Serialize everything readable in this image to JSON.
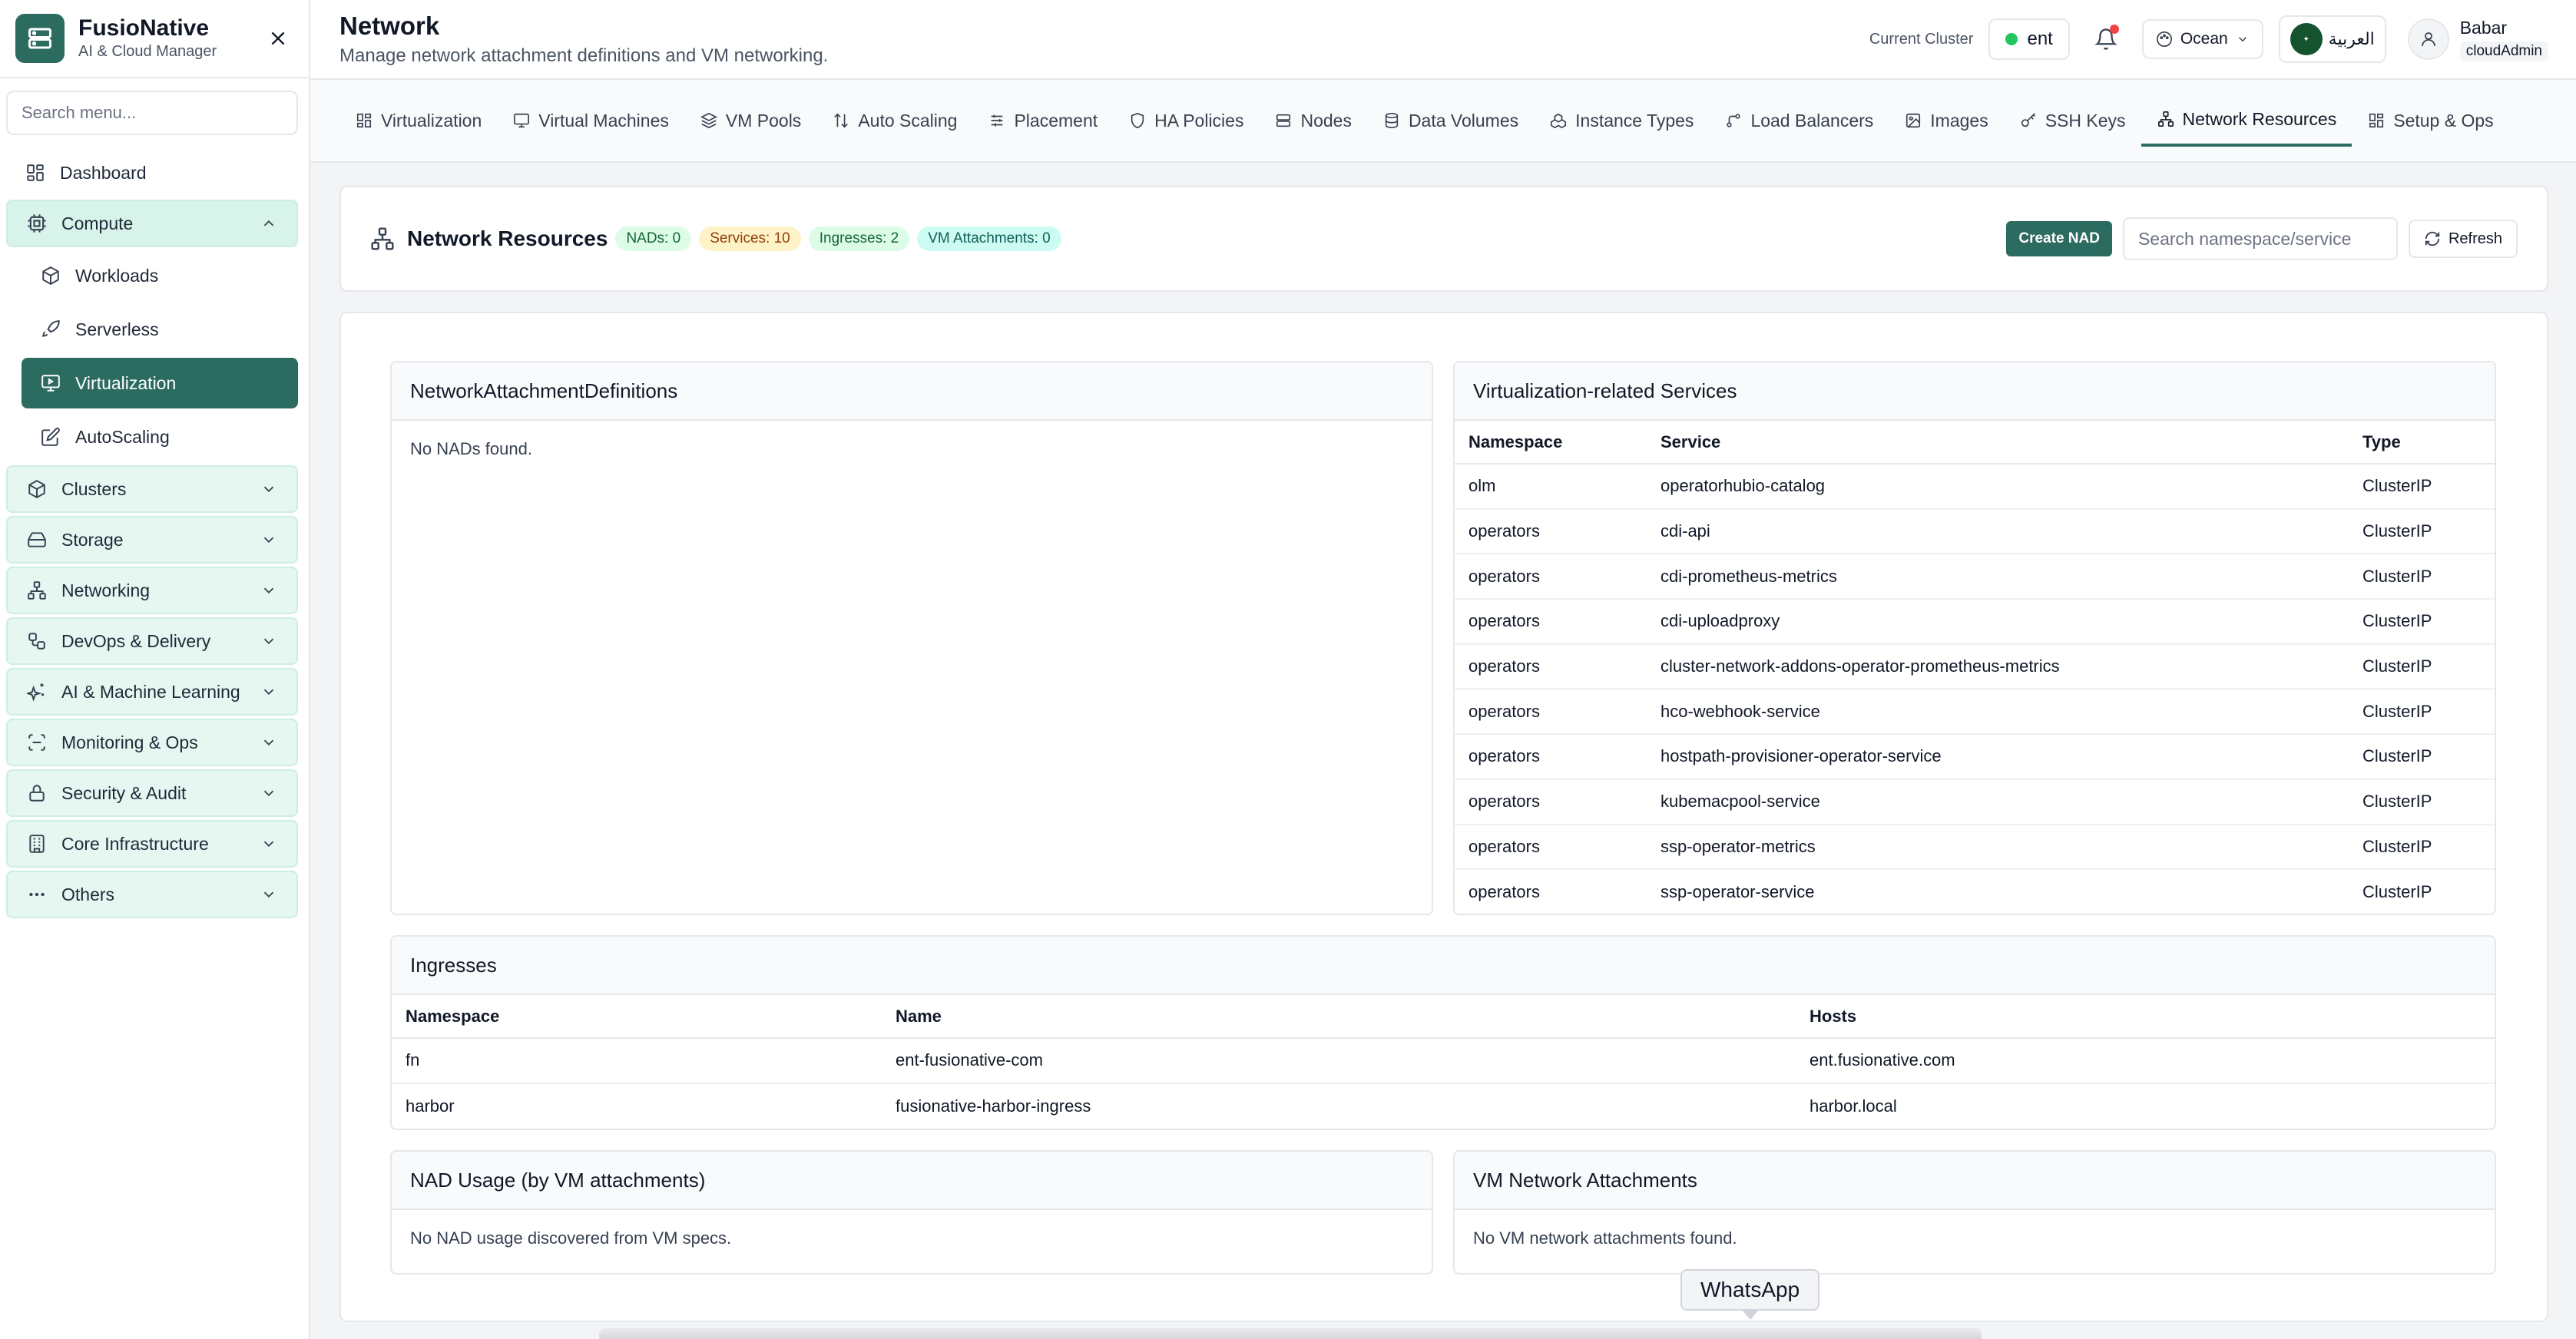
{
  "brand": {
    "name": "FusioNative",
    "subtitle": "AI & Cloud Manager"
  },
  "sidebar": {
    "search_placeholder": "Search menu...",
    "dashboard": "Dashboard",
    "compute": {
      "label": "Compute",
      "children": [
        "Workloads",
        "Serverless",
        "Virtualization",
        "AutoScaling"
      ],
      "active": "Virtualization"
    },
    "groups": [
      "Clusters",
      "Storage",
      "Networking",
      "DevOps & Delivery",
      "AI & Machine Learning",
      "Monitoring & Ops",
      "Security & Audit",
      "Core Infrastructure",
      "Others"
    ]
  },
  "header": {
    "title": "Network",
    "subtitle": "Manage network attachment definitions and VM networking.",
    "cluster_label": "Current Cluster",
    "cluster_name": "ent",
    "theme": "Ocean",
    "language": "العربية",
    "user_name": "Babar",
    "user_role": "cloudAdmin"
  },
  "tabs": {
    "items": [
      "Virtualization",
      "Virtual Machines",
      "VM Pools",
      "Auto Scaling",
      "Placement",
      "HA Policies",
      "Nodes",
      "Data Volumes",
      "Instance Types",
      "Load Balancers",
      "Images",
      "SSH Keys",
      "Network Resources",
      "Setup & Ops"
    ],
    "active": "Network Resources"
  },
  "resources": {
    "title": "Network Resources",
    "badges": {
      "nads": "NADs: 0",
      "services": "Services: 10",
      "ingresses": "Ingresses: 2",
      "vm_attachments": "VM Attachments: 0"
    },
    "create_button": "Create NAD",
    "search_placeholder": "Search namespace/service",
    "refresh_button": "Refresh"
  },
  "nads": {
    "title": "NetworkAttachmentDefinitions",
    "empty": "No NADs found."
  },
  "services": {
    "title": "Virtualization-related Services",
    "columns": [
      "Namespace",
      "Service",
      "Type"
    ],
    "rows": [
      [
        "olm",
        "operatorhubio-catalog",
        "ClusterIP"
      ],
      [
        "operators",
        "cdi-api",
        "ClusterIP"
      ],
      [
        "operators",
        "cdi-prometheus-metrics",
        "ClusterIP"
      ],
      [
        "operators",
        "cdi-uploadproxy",
        "ClusterIP"
      ],
      [
        "operators",
        "cluster-network-addons-operator-prometheus-metrics",
        "ClusterIP"
      ],
      [
        "operators",
        "hco-webhook-service",
        "ClusterIP"
      ],
      [
        "operators",
        "hostpath-provisioner-operator-service",
        "ClusterIP"
      ],
      [
        "operators",
        "kubemacpool-service",
        "ClusterIP"
      ],
      [
        "operators",
        "ssp-operator-metrics",
        "ClusterIP"
      ],
      [
        "operators",
        "ssp-operator-service",
        "ClusterIP"
      ]
    ]
  },
  "ingresses": {
    "title": "Ingresses",
    "columns": [
      "Namespace",
      "Name",
      "Hosts"
    ],
    "rows": [
      [
        "fn",
        "ent-fusionative-com",
        "ent.fusionative.com"
      ],
      [
        "harbor",
        "fusionative-harbor-ingress",
        "harbor.local"
      ]
    ]
  },
  "nad_usage": {
    "title": "NAD Usage (by VM attachments)",
    "empty": "No NAD usage discovered from VM specs."
  },
  "vm_attachments": {
    "title": "VM Network Attachments",
    "empty": "No VM network attachments found."
  },
  "tooltip": "WhatsApp",
  "colors": {
    "accent": "#2c6b5f",
    "sidebar_group_bg": "#e6f7f2",
    "status_green": "#22c55e",
    "notification_red": "#ef4444"
  }
}
